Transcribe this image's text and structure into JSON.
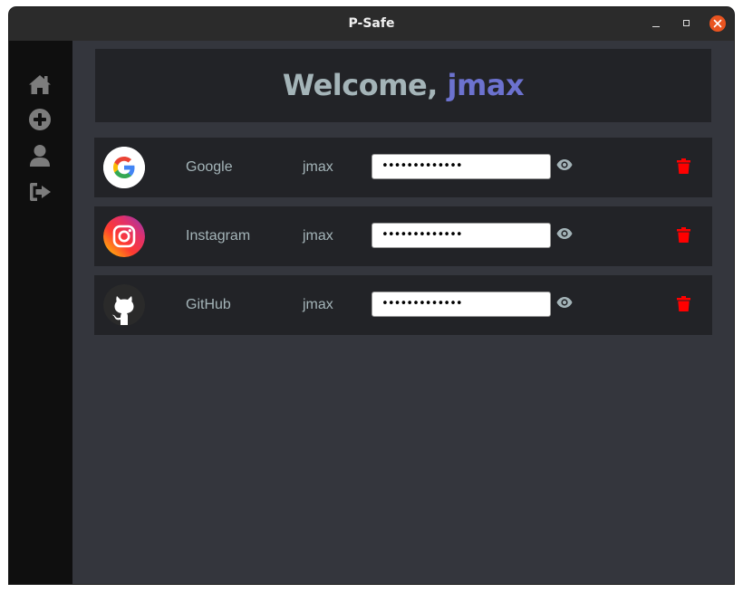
{
  "window": {
    "title": "P-Safe"
  },
  "sidebar": {
    "items": [
      {
        "icon": "home-icon"
      },
      {
        "icon": "plus-circle-icon"
      },
      {
        "icon": "user-icon"
      },
      {
        "icon": "sign-out-icon"
      }
    ]
  },
  "welcome": {
    "prefix": "Welcome, ",
    "username": "jmax"
  },
  "accounts": [
    {
      "service": "Google",
      "username": "jmax",
      "password": "•••••••••••••",
      "logo": "google-logo-icon"
    },
    {
      "service": "Instagram",
      "username": "jmax",
      "password": "•••••••••••••",
      "logo": "instagram-logo-icon"
    },
    {
      "service": "GitHub",
      "username": "jmax",
      "password": "•••••••••••••",
      "logo": "github-logo-icon"
    }
  ],
  "colors": {
    "accent": "#6c72cf",
    "delete": "#ff0000",
    "text": "#a4b4b8",
    "close": "#e95420"
  }
}
